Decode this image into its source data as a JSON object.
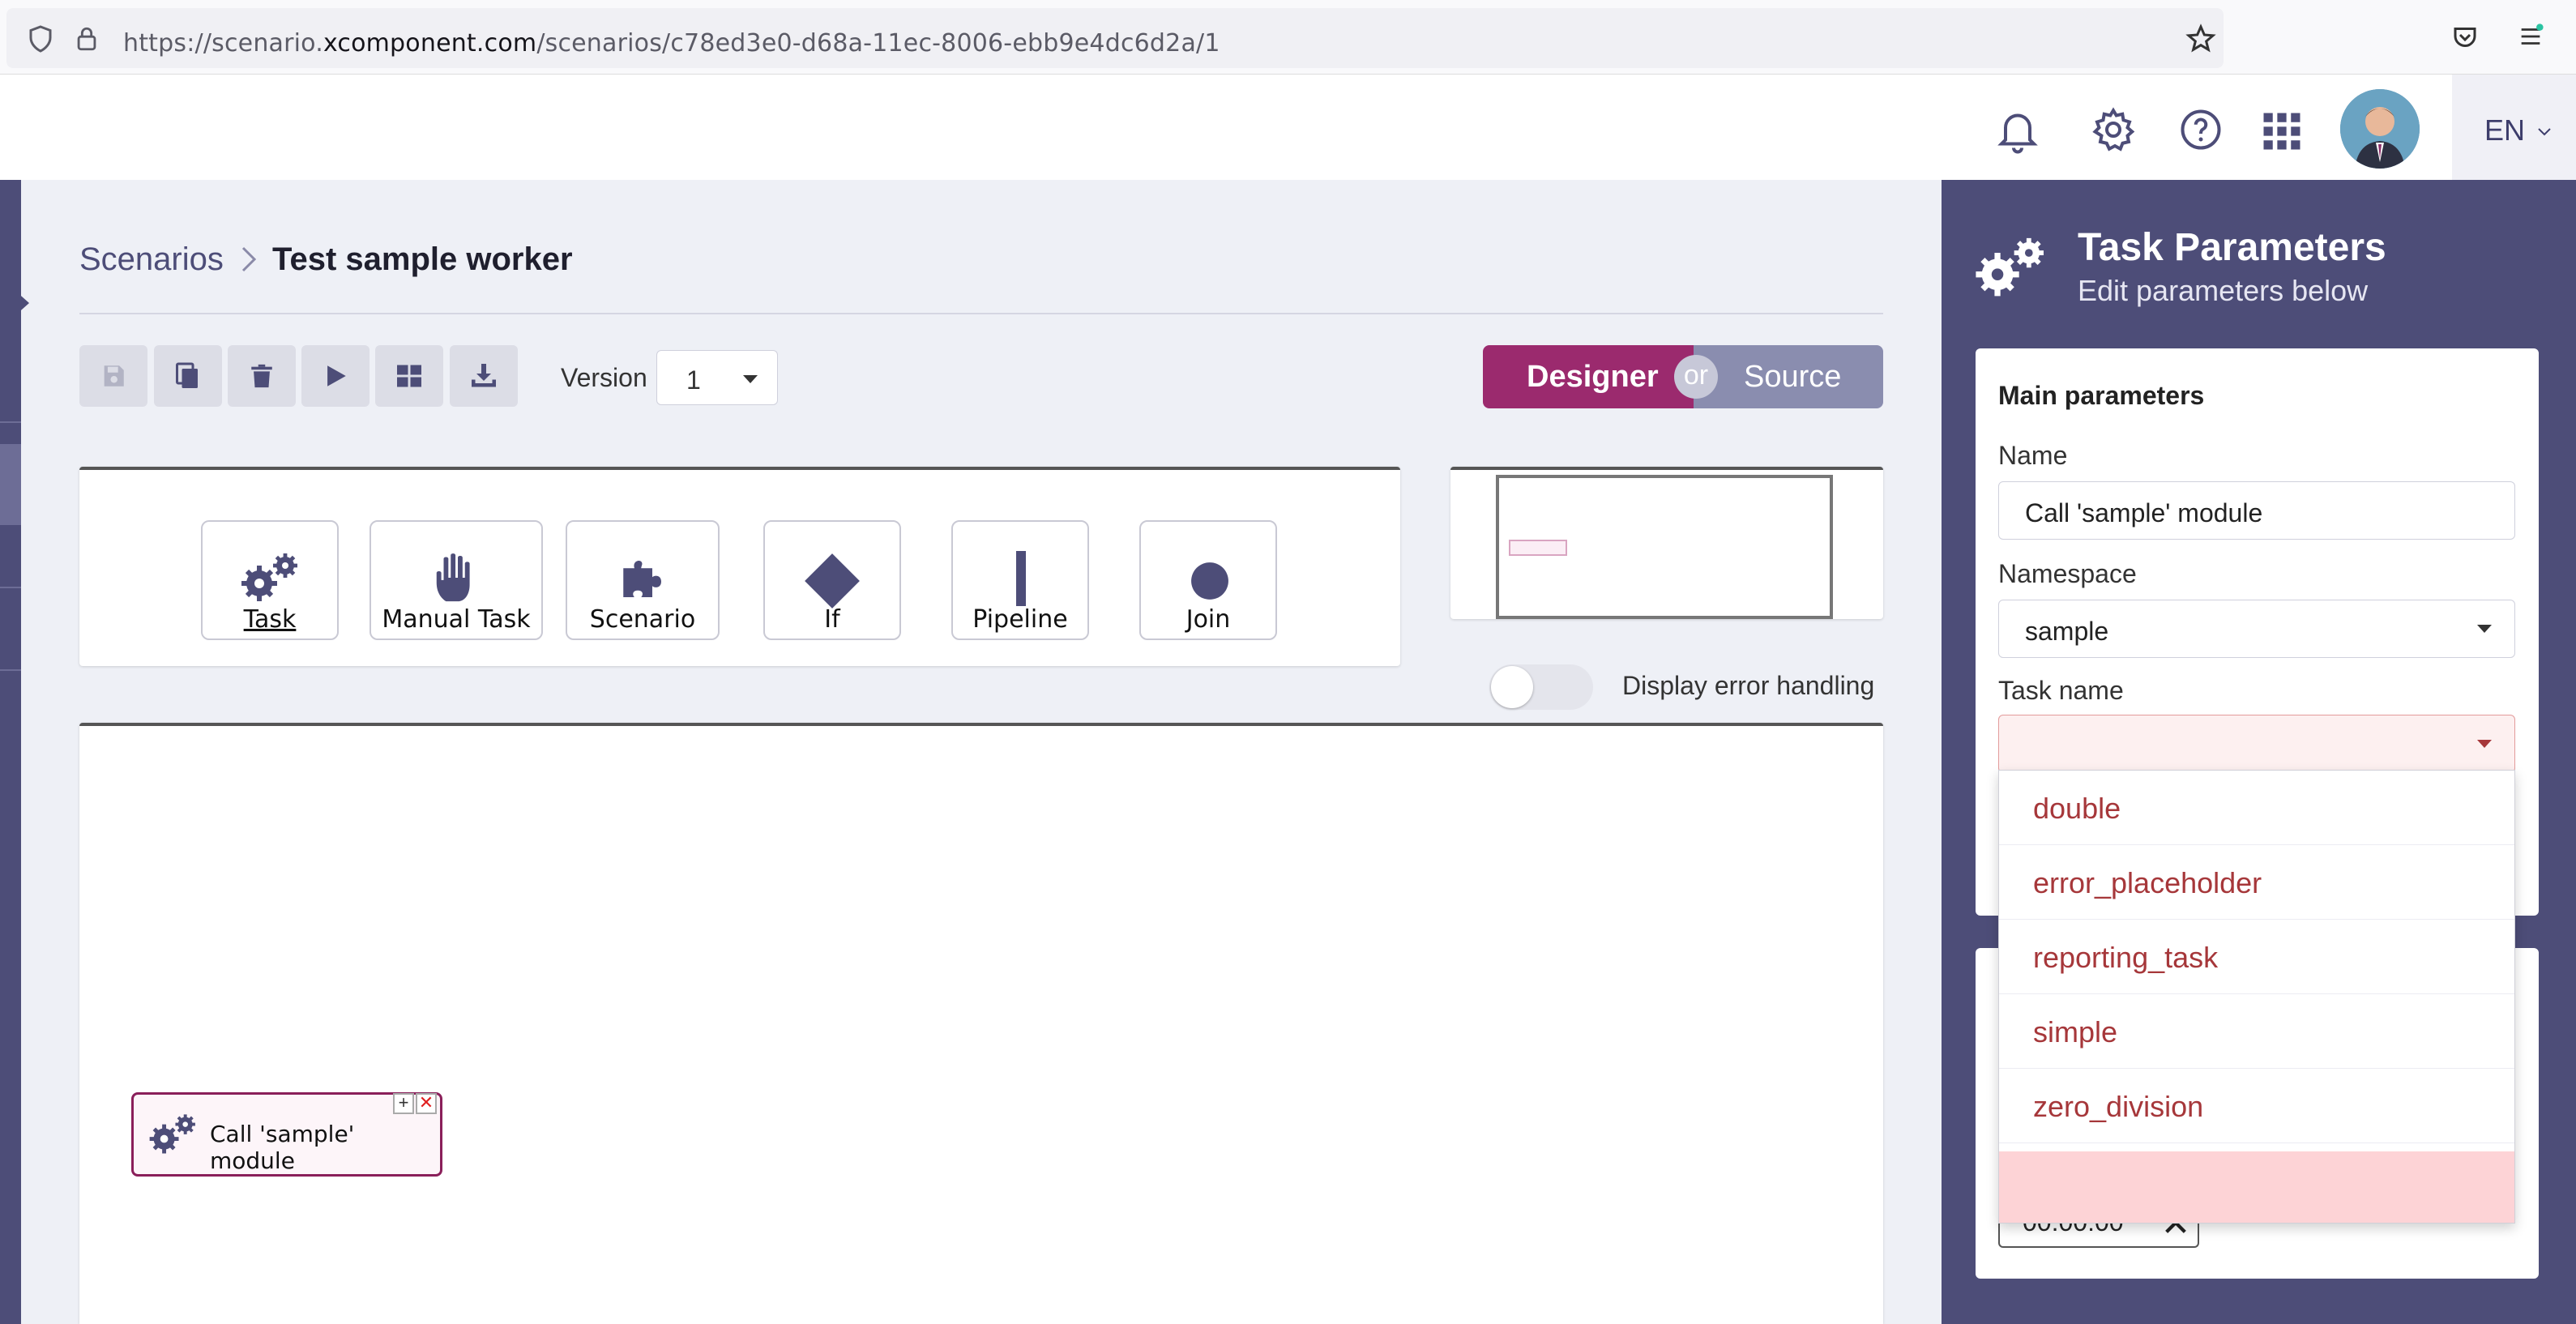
{
  "browser": {
    "url_prefix": "https://scenario.",
    "url_domain": "xcomponent.com",
    "url_path": "/scenarios/c78ed3e0-d68a-11ec-8006-ebb9e4dc6d2a/1"
  },
  "header": {
    "language": "EN",
    "icons": [
      "bell-icon",
      "gear-icon",
      "help-icon",
      "apps-grid-icon"
    ]
  },
  "breadcrumb": {
    "root": "Scenarios",
    "current": "Test sample worker"
  },
  "toolbar": {
    "version_label": "Version",
    "version_value": "1",
    "designer_label": "Designer",
    "or_label": "or",
    "source_label": "Source"
  },
  "palette": {
    "items": [
      {
        "label": "Task"
      },
      {
        "label": "Manual Task"
      },
      {
        "label": "Scenario"
      },
      {
        "label": "If"
      },
      {
        "label": "Pipeline"
      },
      {
        "label": "Join"
      }
    ]
  },
  "error_handling": {
    "label": "Display error handling",
    "enabled": false
  },
  "canvas": {
    "node_label": "Call 'sample' module"
  },
  "panel": {
    "title": "Task Parameters",
    "subtitle": "Edit parameters below",
    "section": "Main parameters",
    "name_label": "Name",
    "name_value": "Call 'sample' module",
    "namespace_label": "Namespace",
    "namespace_value": "sample",
    "task_name_label": "Task name",
    "task_name_value": "",
    "task_options": [
      "double",
      "error_placeholder",
      "reporting_task",
      "simple",
      "zero_division"
    ],
    "timeout_value": "00:00:00"
  },
  "colors": {
    "primary": "#4d4d78",
    "designer": "#9b2a6e",
    "source": "#8a8daf",
    "option_text": "#a6373a"
  }
}
